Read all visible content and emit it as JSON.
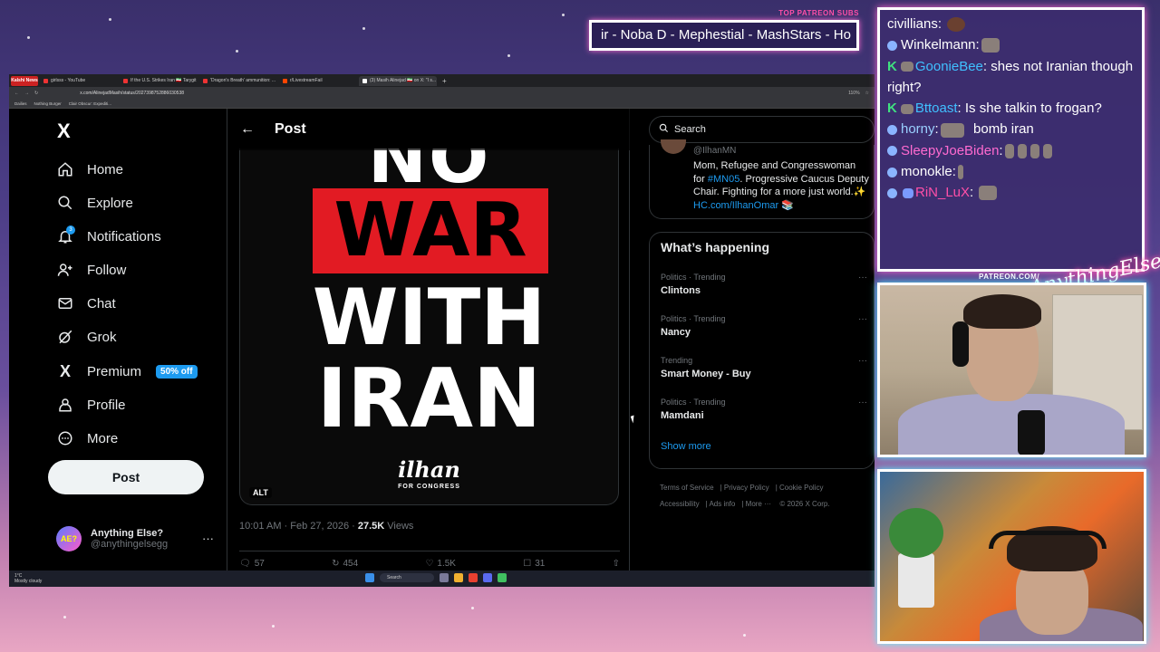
{
  "patreon": {
    "label": "TOP PATREON SUBS",
    "ticker": "ir - Noba D - Mephestial - MashStars - Ho"
  },
  "browser": {
    "tabs": [
      {
        "label": "Kalshi News"
      },
      {
        "label": "girlsss - YouTube"
      },
      {
        "label": "If the U.S. Strikes Iran 🇮🇷 Tarygit"
      },
      {
        "label": "'Dragon's Breath' ammunition: ..."
      },
      {
        "label": "r/LivestreamFail"
      },
      {
        "label": "(3) Masih Alinejad 🇮🇷 on X: \"I s..."
      }
    ],
    "url": "x.com/AlinejadMasih/status/2027398752886030538",
    "zoom": "110%",
    "bookmarks": [
      "Dailies",
      "Nothing Burger",
      "Clair Obscur: Expediti..."
    ]
  },
  "nav": {
    "logo": "X",
    "items": [
      {
        "label": "Home",
        "icon": "home-icon"
      },
      {
        "label": "Explore",
        "icon": "search-icon"
      },
      {
        "label": "Notifications",
        "icon": "bell-icon",
        "badge": "3"
      },
      {
        "label": "Follow",
        "icon": "person-plus-icon"
      },
      {
        "label": "Chat",
        "icon": "mail-icon"
      },
      {
        "label": "Grok",
        "icon": "grok-icon"
      },
      {
        "label": "Premium",
        "icon": "x-premium-icon",
        "badge": "50% off"
      },
      {
        "label": "Profile",
        "icon": "profile-icon"
      },
      {
        "label": "More",
        "icon": "more-circle-icon"
      }
    ],
    "post_button": "Post",
    "account": {
      "name": "Anything Else?",
      "handle": "@anythingelsegg",
      "avatar_text": "AE?"
    }
  },
  "main": {
    "header_title": "Post",
    "poster": {
      "line1": "NO",
      "line2": "WAR",
      "line3": "WITH",
      "line4": "IRAN",
      "signature": "ilhan",
      "sub": "FOR CONGRESS",
      "alt": "ALT"
    },
    "meta": {
      "time": "10:01 AM · Feb 27, 2026 · ",
      "views_count": "27.5K",
      "views_label": " Views"
    },
    "actions": {
      "replies": "57",
      "reposts": "454",
      "likes": "1.5K",
      "bookmarks": "31"
    }
  },
  "right": {
    "search_placeholder": "Search",
    "profile_card": {
      "handle": "@IlhanMN",
      "bio_pre": "Mom, Refugee and Congresswoman for ",
      "bio_tag": "#MN05",
      "bio_mid": ". Progressive Caucus Deputy Chair. Fighting for a more just world.✨ ",
      "bio_link": "HC.com/IlhanOmar",
      "bio_end": " 📚"
    },
    "happening_title": "What’s happening",
    "trends": [
      {
        "context": "Politics · Trending",
        "name": "Clintons"
      },
      {
        "context": "Politics · Trending",
        "name": "Nancy"
      },
      {
        "context": "Trending",
        "name": "Smart Money - Buy"
      },
      {
        "context": "Politics · Trending",
        "name": "Mamdani"
      }
    ],
    "show_more": "Show more",
    "footer": [
      "Terms of Service",
      "Privacy Policy",
      "Cookie Policy",
      "Accessibility",
      "Ads info",
      "More ···",
      "© 2026 X Corp."
    ]
  },
  "taskbar": {
    "weather_temp": "1°C",
    "weather_desc": "Mostly cloudy",
    "search": "Search"
  },
  "chat": {
    "messages": [
      {
        "user": "civillians",
        "text": "",
        "color": "#ffffff",
        "badges": []
      },
      {
        "user": "Winkelmann",
        "text": "",
        "color": "#ffffff",
        "badges": [
          "blue"
        ]
      },
      {
        "user": "GoonieBee",
        "text": "shes not Iranian though right?",
        "color": "#40c0ff",
        "badges": [
          "k",
          "emote"
        ]
      },
      {
        "user": "Bttoast",
        "text": "Is she talkin to frogan?",
        "color": "#40c0ff",
        "badges": [
          "k",
          "emote"
        ]
      },
      {
        "user": "horny",
        "text": "bomb iran",
        "color": "#9ad0ff",
        "badges": [
          "blue"
        ]
      },
      {
        "user": "SleepyJoeBiden",
        "text": "",
        "color": "#ff6ad0",
        "badges": [
          "blue"
        ]
      },
      {
        "user": "monokle",
        "text": "",
        "color": "#ffffff",
        "badges": [
          "blue"
        ]
      },
      {
        "user": "RiN_LuX",
        "text": "",
        "color": "#ff4fa8",
        "badges": [
          "blue",
          "emote"
        ]
      }
    ]
  },
  "cams": {
    "label": "PATREON.COM/",
    "logo": "AnythingElse?"
  },
  "colors": {
    "accent": "#1d9bf0",
    "poster_red": "#e21b23",
    "neon_pink": "#ff6bd0",
    "neon_cyan": "#4ff0ff"
  }
}
